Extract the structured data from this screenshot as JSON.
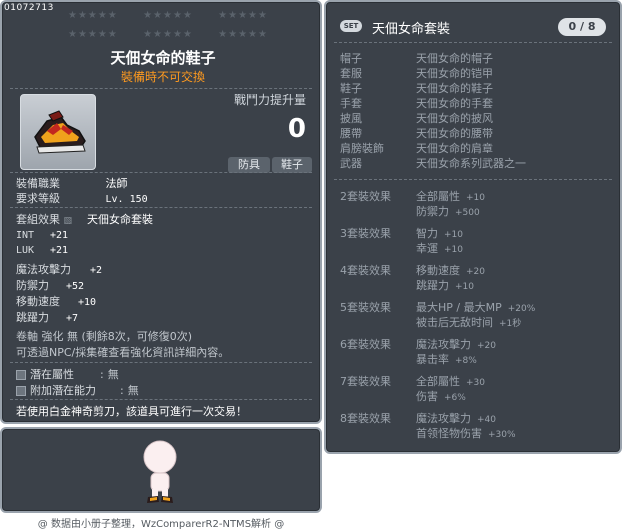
{
  "item": {
    "id": "01072713",
    "name": "天佃女命的鞋子",
    "trade_note": "裝備時不可交換",
    "power_label": "戰鬥力提升量",
    "power_value": "0",
    "tags": [
      "防具",
      "鞋子"
    ],
    "job_label": "裝備職業",
    "job_value": "法師",
    "level_label": "要求等級",
    "level_value": "Lv. 150",
    "set_label": "套組效果",
    "set_value": "天佃女命套裝",
    "stats": [
      {
        "label": "INT",
        "value": "+21"
      },
      {
        "label": "LUK",
        "value": "+21"
      },
      {
        "label": "魔法攻擊力",
        "value": "+2"
      },
      {
        "label": "防禦力",
        "value": "+52"
      },
      {
        "label": "移動速度",
        "value": "+10"
      },
      {
        "label": "跳躍力",
        "value": "+7"
      }
    ],
    "scroll_line": "卷軸 強化 無 (剩餘8次，可修復0次)",
    "star_force_line": "可透過NPC/採集確查看強化資訊詳細內容。",
    "potential_label": "潛在屬性",
    "potential_value": "無",
    "add_potential_label": "附加潛在能力",
    "add_potential_value": "無",
    "scissors_line": "若使用白金神奇剪刀，該道具可進行一次交易！"
  },
  "footer": "@ 数据由小册子整理，WzComparerR2-NTMS解析 @",
  "set": {
    "badge": "SET",
    "title": "天佃女命套裝",
    "count": "0 / 8",
    "pieces": [
      {
        "slot": "帽子",
        "name": "天佃女命的帽子"
      },
      {
        "slot": "套服",
        "name": "天佃女命的铠甲"
      },
      {
        "slot": "鞋子",
        "name": "天佃女命的鞋子"
      },
      {
        "slot": "手套",
        "name": "天佃女命的手套"
      },
      {
        "slot": "披風",
        "name": "天佃女命的披风"
      },
      {
        "slot": "腰帶",
        "name": "天佃女命的腰带"
      },
      {
        "slot": "肩膀裝飾",
        "name": "天佃女命的肩章"
      },
      {
        "slot": "武器",
        "name": "天佃女命系列武器之一"
      }
    ],
    "bonuses": [
      {
        "label": "2套裝效果",
        "lines": [
          {
            "t": "全部屬性",
            "v": "+10"
          },
          {
            "t": "防禦力",
            "v": "+500"
          }
        ]
      },
      {
        "label": "3套裝效果",
        "lines": [
          {
            "t": "智力",
            "v": "+10"
          },
          {
            "t": "幸運",
            "v": "+10"
          }
        ]
      },
      {
        "label": "4套裝效果",
        "lines": [
          {
            "t": "移動速度",
            "v": "+20"
          },
          {
            "t": "跳躍力",
            "v": "+10"
          }
        ]
      },
      {
        "label": "5套裝效果",
        "lines": [
          {
            "t": "最大HP / 最大MP",
            "v": "+20%"
          },
          {
            "t": "被击后无敌时间",
            "v": "+1秒"
          }
        ]
      },
      {
        "label": "6套裝效果",
        "lines": [
          {
            "t": "魔法攻擊力",
            "v": "+20"
          },
          {
            "t": "暴击率",
            "v": "+8%"
          }
        ]
      },
      {
        "label": "7套裝效果",
        "lines": [
          {
            "t": "全部屬性",
            "v": "+30"
          },
          {
            "t": "伤害",
            "v": "+6%"
          }
        ]
      },
      {
        "label": "8套裝效果",
        "lines": [
          {
            "t": "魔法攻擊力",
            "v": "+40"
          },
          {
            "t": "首领怪物伤害",
            "v": "+30%"
          }
        ]
      }
    ]
  }
}
